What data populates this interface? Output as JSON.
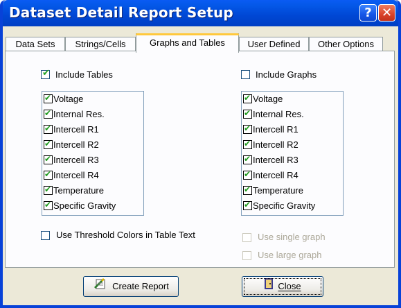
{
  "window": {
    "title": "Dataset Detail Report Setup",
    "help_glyph": "?",
    "close_glyph": "✕"
  },
  "tabs": [
    {
      "label": "Data Sets",
      "active": false
    },
    {
      "label": "Strings/Cells",
      "active": false
    },
    {
      "label": "Graphs and Tables",
      "active": true
    },
    {
      "label": "User Defined",
      "active": false
    },
    {
      "label": "Other Options",
      "active": false
    }
  ],
  "tables": {
    "include_label": "Include Tables",
    "include_checked": true,
    "items": [
      "Voltage",
      "Internal Res.",
      "Intercell R1",
      "Intercell R2",
      "Intercell R3",
      "Intercell R4",
      "Temperature",
      "Specific Gravity"
    ],
    "threshold_label": "Use Threshold Colors in Table Text",
    "threshold_checked": false
  },
  "graphs": {
    "include_label": "Include Graphs",
    "include_checked": false,
    "items": [
      "Voltage",
      "Internal Res.",
      "Intercell R1",
      "Intercell R2",
      "Intercell R3",
      "Intercell R4",
      "Temperature",
      "Specific Gravity"
    ],
    "single_label": "Use single graph",
    "large_label": "Use large graph"
  },
  "buttons": {
    "create": "Create Report",
    "close": "Close"
  },
  "colors": {
    "titlebar": "#0047d4",
    "face": "#ece9d8",
    "tick": "#21a121"
  }
}
